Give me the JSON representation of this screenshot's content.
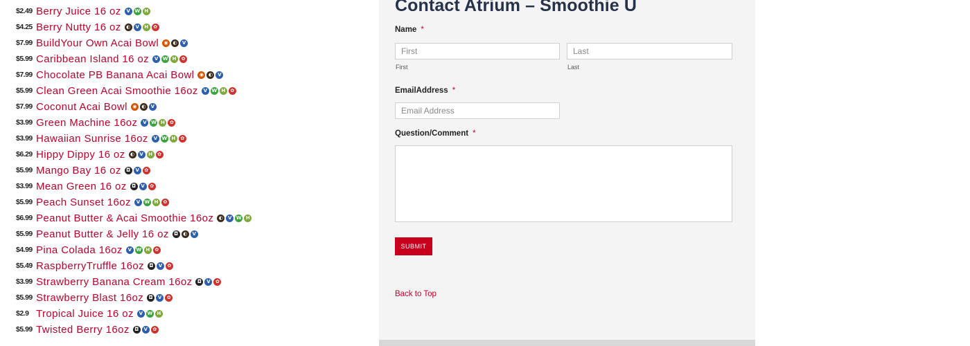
{
  "menu": {
    "items": [
      {
        "price": "$2.49",
        "name": "Berry Juice 16 oz",
        "icons": [
          "v",
          "g",
          "h"
        ]
      },
      {
        "price": "$4.25",
        "name": "Berry Nutty 16 oz",
        "icons": [
          "n",
          "v",
          "h",
          "d"
        ]
      },
      {
        "price": "$7.99",
        "name": "BuildYour Own Acai Bowl",
        "icons": [
          "s",
          "n",
          "v"
        ]
      },
      {
        "price": "$5.99",
        "name": "Caribbean Island 16 oz",
        "icons": [
          "v",
          "g",
          "h",
          "d"
        ]
      },
      {
        "price": "$7.99",
        "name": "Chocolate PB Banana Acai Bowl",
        "icons": [
          "s",
          "n",
          "v"
        ]
      },
      {
        "price": "$5.99",
        "name": "Clean Green Acai Smoothie 16oz",
        "icons": [
          "v",
          "g",
          "h",
          "d"
        ]
      },
      {
        "price": "$7.99",
        "name": "Coconut Acai Bowl",
        "icons": [
          "s",
          "n",
          "v"
        ]
      },
      {
        "price": "$3.99",
        "name": "Green Machine 16oz",
        "icons": [
          "v",
          "g",
          "h",
          "d"
        ]
      },
      {
        "price": "$3.99",
        "name": "Hawaiian Sunrise 16oz",
        "icons": [
          "v",
          "g",
          "h",
          "d"
        ]
      },
      {
        "price": "$6.29",
        "name": "Hippy Dippy 16 oz",
        "icons": [
          "n",
          "v",
          "h",
          "d"
        ]
      },
      {
        "price": "$5.99",
        "name": "Mango Bay 16 oz",
        "icons": [
          "m",
          "v",
          "d"
        ]
      },
      {
        "price": "$3.99",
        "name": "Mean Green 16 oz",
        "icons": [
          "m",
          "v",
          "d"
        ]
      },
      {
        "price": "$5.99",
        "name": "Peach Sunset 16oz",
        "icons": [
          "v",
          "g",
          "h",
          "d"
        ]
      },
      {
        "price": "$6.99",
        "name": "Peanut Butter & Acai Smoothie 16oz",
        "icons": [
          "n",
          "v",
          "g",
          "h"
        ]
      },
      {
        "price": "$5.99",
        "name": "Peanut Butter & Jelly 16 oz",
        "icons": [
          "m",
          "n",
          "v"
        ]
      },
      {
        "price": "$4.99",
        "name": "Pina Colada 16oz",
        "icons": [
          "v",
          "g",
          "h",
          "d"
        ]
      },
      {
        "price": "$5.49",
        "name": "RaspberryTruffle 16oz",
        "icons": [
          "m",
          "v",
          "d"
        ]
      },
      {
        "price": "$3.99",
        "name": "Strawberry Banana Cream 16oz",
        "icons": [
          "m",
          "v",
          "d"
        ]
      },
      {
        "price": "$5.99",
        "name": "Strawberry Blast 16oz",
        "icons": [
          "m",
          "v",
          "d"
        ]
      },
      {
        "price": "$2.9",
        "name": "Tropical Juice 16 oz",
        "icons": [
          "v",
          "g",
          "h"
        ]
      },
      {
        "price": "$5.99",
        "name": "Twisted Berry 16oz",
        "icons": [
          "m",
          "v",
          "d"
        ]
      }
    ],
    "icon_glyphs": {
      "v": "V",
      "g": "W",
      "h": "H",
      "d": "✿",
      "n": "◐",
      "s": "◉",
      "m": "◘",
      "e": "E"
    },
    "icon_names": {
      "v": "vegan-icon",
      "g": "gluten-free-icon",
      "h": "healthy-icon",
      "d": "dairy-free-icon",
      "n": "nuts-icon",
      "s": "spicy-icon",
      "m": "contains-dairy-icon",
      "e": "egg-icon"
    }
  },
  "form": {
    "title": "Contact Atrium – Smoothie U",
    "name_label": "Name",
    "required_mark": "*",
    "first_placeholder": "First",
    "first_sublabel": "First",
    "last_placeholder": "Last",
    "last_sublabel": "Last",
    "email_label": "EmailAddress",
    "email_placeholder": "Email Address",
    "comment_label": "Question/Comment",
    "submit_label": "SUBMIT",
    "back_to_top": "Back to Top"
  },
  "colors": {
    "accent": "#c0002b",
    "submit": "#c8001e",
    "title": "#26324a",
    "panel": "#f4f4f4"
  }
}
